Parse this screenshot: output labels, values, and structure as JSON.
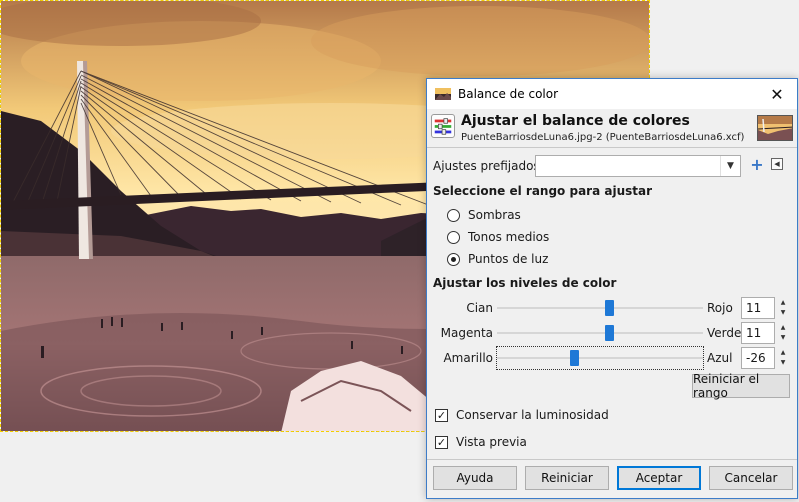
{
  "dialog": {
    "window_title": "Balance de color",
    "close_symbol": "✕",
    "heading": "Ajustar el balance de colores",
    "subtitle": "PuenteBarriosdeLuna6.jpg-2 (PuenteBarriosdeLuna6.xcf)",
    "presets": {
      "label": "Ajustes prefijados:",
      "value": "",
      "add_icon": "plus-icon",
      "menu_icon": "menu-arrow-icon"
    },
    "range_section": {
      "title": "Seleccione el rango para ajustar",
      "options": [
        {
          "label": "Sombras",
          "selected": false
        },
        {
          "label": "Tonos medios",
          "selected": false
        },
        {
          "label": "Puntos de luz",
          "selected": true
        }
      ]
    },
    "levels_section": {
      "title": "Ajustar los niveles de color",
      "sliders": [
        {
          "left": "Cian",
          "right": "Rojo",
          "value": "11",
          "fraction": 0.55
        },
        {
          "left": "Magenta",
          "right": "Verde",
          "value": "11",
          "fraction": 0.55
        },
        {
          "left": "Amarillo",
          "right": "Azul",
          "value": "-26",
          "fraction": 0.37
        }
      ],
      "reset_range_label": "Reiniciar el rango"
    },
    "preserve_luminosity": {
      "label": "Conservar la luminosidad",
      "checked": true
    },
    "preview": {
      "label": "Vista previa",
      "checked": true
    },
    "buttons": {
      "help": "Ayuda",
      "reset": "Reiniciar",
      "ok": "Aceptar",
      "cancel": "Cancelar"
    }
  },
  "colors": {
    "accent": "#1e78d6",
    "selection_dash": "#f5d000",
    "dialog_border": "#3d7cc8"
  }
}
